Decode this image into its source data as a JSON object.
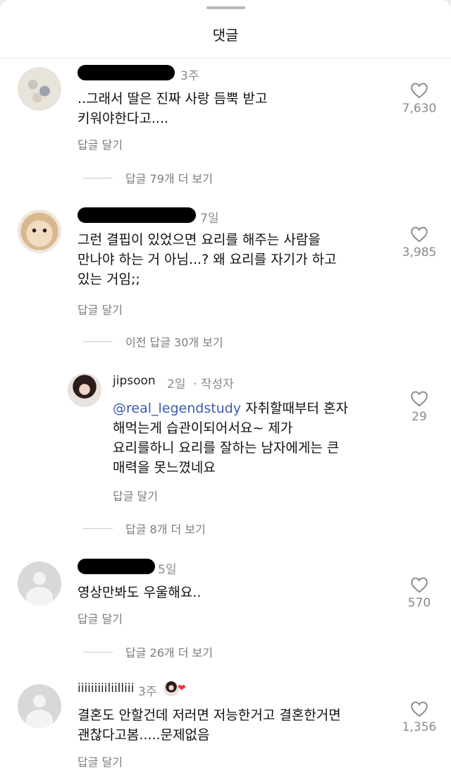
{
  "header": {
    "title": "댓글"
  },
  "icons": {
    "like": "heart-outline-icon",
    "author_like": "red-heart-icon"
  },
  "colors": {
    "mention": "#3b5bb0",
    "author_heart": "#ff3040"
  },
  "comments": [
    {
      "username": "",
      "time": "3주",
      "text": "..그래서 딸은 진짜 사랑 듬뿍 받고\n키워야한다고....",
      "reply_label": "답글 달기",
      "likes": "7,630",
      "more_replies": "답글 79개 더 보기"
    },
    {
      "username": "",
      "time": "7일",
      "text": "그런 결핍이 있었으면 요리를 해주는 사람을\n만나야 하는 거 아님...? 왜 요리를 자기가 하고\n있는 거임;;",
      "reply_label": "답글 달기",
      "likes": "3,985",
      "prev_replies": "이전 답글 30개 보기",
      "reply": {
        "username": "jipsoon",
        "time": "2일",
        "author_tag": "· 작성자",
        "mention": "@real_legendstudy",
        "text": " 자취할때부터 혼자\n해먹는게 습관이되어서요~ 제가\n요리를하니 요리를 잘하는 남자에게는 큰\n매력을 못느꼈네요",
        "reply_label": "답글 달기",
        "likes": "29",
        "more_replies": "답글 8개 더 보기"
      }
    },
    {
      "username": "",
      "time": "5일",
      "text": "영상만봐도 우울해요..",
      "reply_label": "답글 달기",
      "likes": "570",
      "more_replies": "답글 26개 더 보기"
    },
    {
      "username": "iiiiiiiiiliilliii",
      "time": "3주",
      "text": "결혼도 안할건데 저러면 저능한거고 결혼한거면\n괜찮다고봄.....문제없음",
      "reply_label": "답글 달기",
      "likes": "1,356"
    }
  ]
}
